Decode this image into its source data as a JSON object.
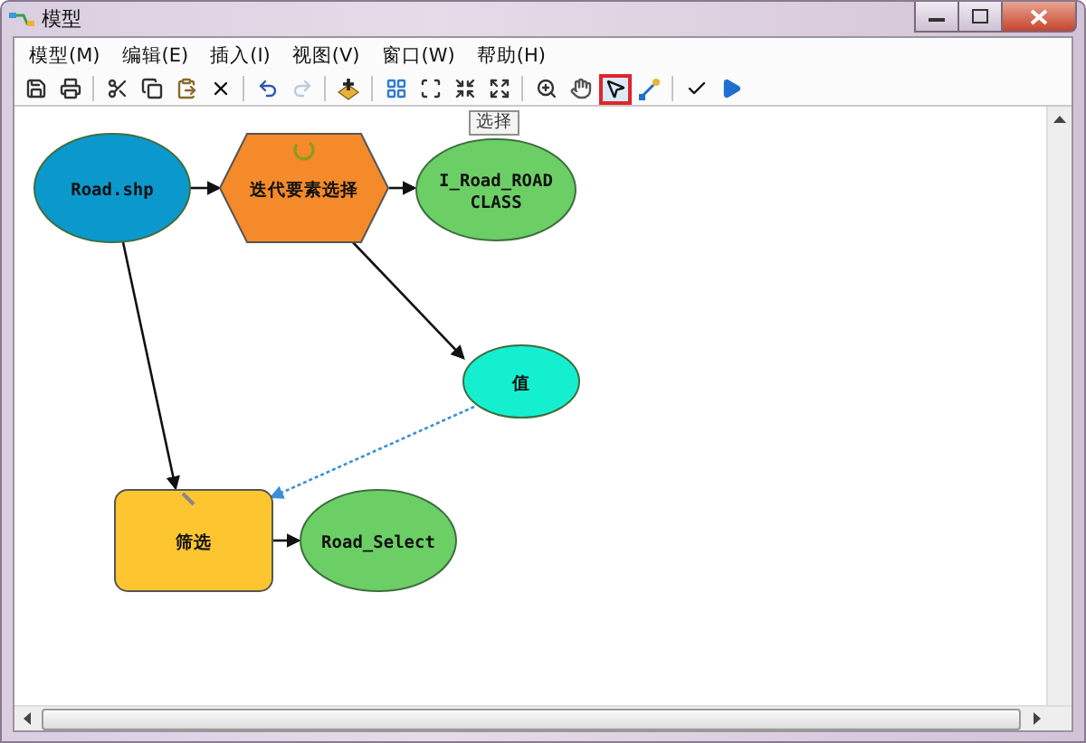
{
  "window": {
    "title": "模型"
  },
  "menu": [
    {
      "label": "模型(M)"
    },
    {
      "label": "编辑(E)"
    },
    {
      "label": "插入(I)"
    },
    {
      "label": "视图(V)"
    },
    {
      "label": "窗口(W)"
    },
    {
      "label": "帮助(H)"
    }
  ],
  "toolbar": [
    [
      {
        "kind": "save",
        "selected": false,
        "disabled": false
      },
      {
        "kind": "print",
        "selected": false,
        "disabled": false
      }
    ],
    [
      {
        "kind": "cut",
        "selected": false,
        "disabled": false
      },
      {
        "kind": "copy",
        "selected": false,
        "disabled": false
      },
      {
        "kind": "paste",
        "selected": false,
        "disabled": false
      },
      {
        "kind": "delete",
        "selected": false,
        "disabled": false
      }
    ],
    [
      {
        "kind": "undo",
        "selected": false,
        "disabled": false
      },
      {
        "kind": "redo",
        "selected": false,
        "disabled": true
      }
    ],
    [
      {
        "kind": "add",
        "selected": false,
        "disabled": false
      }
    ],
    [
      {
        "kind": "layout",
        "selected": false,
        "disabled": false
      },
      {
        "kind": "extent",
        "selected": false,
        "disabled": false
      },
      {
        "kind": "shrink",
        "selected": false,
        "disabled": false
      },
      {
        "kind": "expand",
        "selected": false,
        "disabled": false
      }
    ],
    [
      {
        "kind": "zoom",
        "selected": false,
        "disabled": false
      },
      {
        "kind": "pan",
        "selected": false,
        "disabled": false
      },
      {
        "kind": "select",
        "selected": true,
        "disabled": false
      },
      {
        "kind": "connect",
        "selected": false,
        "disabled": false
      }
    ],
    [
      {
        "kind": "validate",
        "selected": false,
        "disabled": false
      },
      {
        "kind": "run",
        "selected": false,
        "disabled": false
      }
    ]
  ],
  "tooltip": "选择",
  "nodes": [
    {
      "kind": "data",
      "label": "Road.shp"
    },
    {
      "kind": "iterator",
      "label": "迭代要素选择"
    },
    {
      "kind": "output",
      "label": "I_Road_ROAD CLASS"
    },
    {
      "kind": "value",
      "label": "值"
    },
    {
      "kind": "tool",
      "label": "筛选"
    },
    {
      "kind": "output",
      "label": "Road_Select"
    }
  ]
}
